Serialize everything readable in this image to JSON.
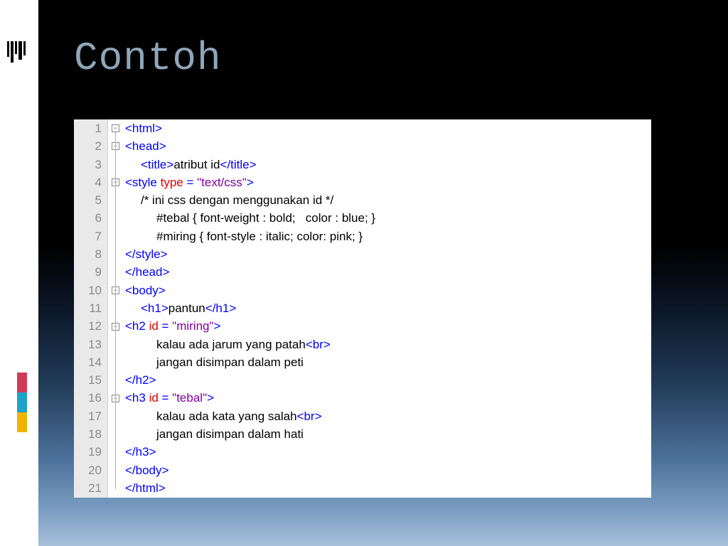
{
  "slide": {
    "title": "Contoh"
  },
  "code": {
    "line_numbers": [
      "1",
      "2",
      "3",
      "4",
      "5",
      "6",
      "7",
      "8",
      "9",
      "10",
      "11",
      "12",
      "13",
      "14",
      "15",
      "16",
      "17",
      "18",
      "19",
      "20",
      "21"
    ],
    "lines": {
      "l1": {
        "tag_open": "<html>"
      },
      "l2": {
        "tag_open": "<head>"
      },
      "l3": {
        "open": "<title>",
        "text": "atribut id",
        "close": "</title>"
      },
      "l4": {
        "open": "<style ",
        "attr": "type",
        "eq": " = ",
        "val": "\"text/css\"",
        "close": ">"
      },
      "l5": {
        "text": "/* ini css dengan menggunakan id */"
      },
      "l6": {
        "text": "#tebal { font-weight : bold;   color : blue; }"
      },
      "l7": {
        "text": "#miring { font-style : italic; color: pink; }"
      },
      "l8": {
        "tag_close": "</style>"
      },
      "l9": {
        "tag_close": "</head>"
      },
      "l10": {
        "tag_open": "<body>"
      },
      "l11": {
        "open": "<h1>",
        "text": "pantun",
        "close": "</h1>"
      },
      "l12": {
        "open": "<h2 ",
        "attr": "id",
        "eq": " = ",
        "val": "\"miring\"",
        "close": ">"
      },
      "l13": {
        "text": "kalau ada jarum yang patah",
        "br": "<br>"
      },
      "l14": {
        "text": "jangan disimpan dalam peti"
      },
      "l15": {
        "tag_close": "</h2>"
      },
      "l16": {
        "open": "<h3 ",
        "attr": "id",
        "eq": " = ",
        "val": "\"tebal\"",
        "close": ">"
      },
      "l17": {
        "text": "kalau ada kata yang salah",
        "br": "<br>"
      },
      "l18": {
        "text": "jangan disimpan dalam hati"
      },
      "l19": {
        "tag_close": "</h3>"
      },
      "l20": {
        "tag_close": "</body>"
      },
      "l21": {
        "tag_close": "</html>"
      }
    }
  }
}
